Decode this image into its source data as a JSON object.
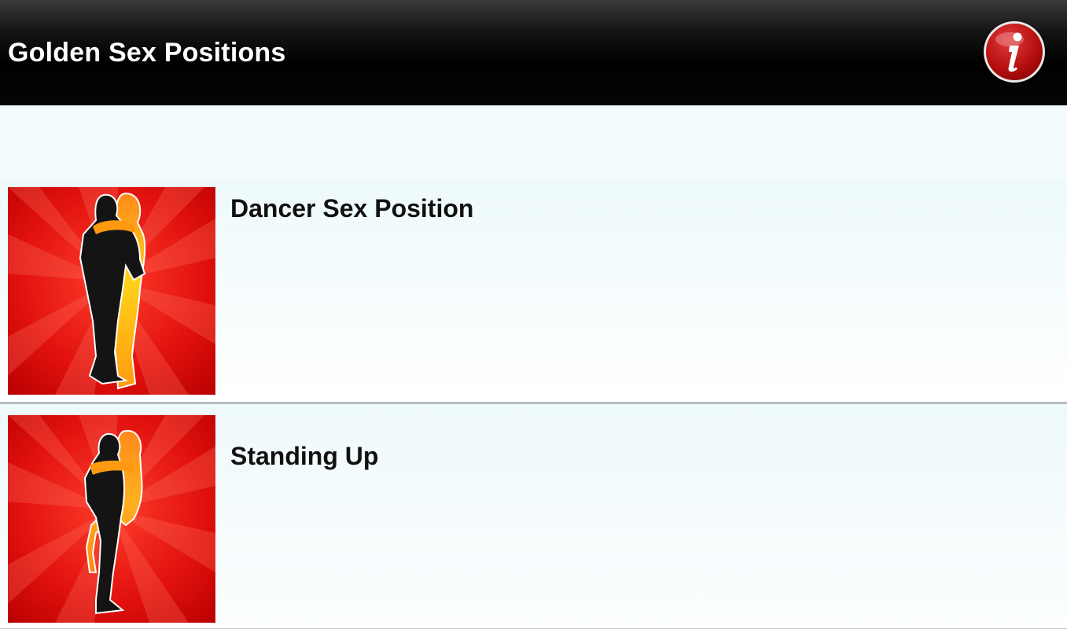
{
  "app": {
    "title": "Golden Sex Positions",
    "info_icon": "info-icon",
    "accent_color": "#c0151a"
  },
  "list": {
    "items": [
      {
        "label": "Dancer Sex Position",
        "thumbnail": "dancer-silhouette-thumbnail"
      },
      {
        "label": "Standing Up",
        "thumbnail": "standing-silhouette-thumbnail"
      }
    ]
  }
}
